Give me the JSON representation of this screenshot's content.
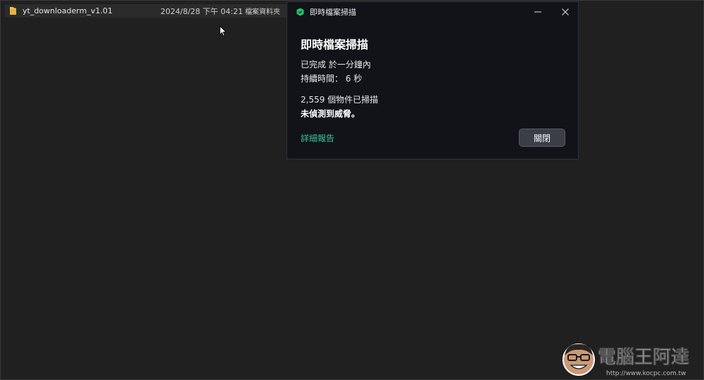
{
  "explorer": {
    "file": {
      "name": "yt_downloaderm_v1.01",
      "modified": "2024/8/28 下午 04:21",
      "type": "檔案資料夾",
      "icon": "folder-icon"
    }
  },
  "dialog": {
    "window_title": "即時檔案掃描",
    "app_icon": "shield-icon",
    "heading": "即時檔案掃描",
    "completed": "已完成 於一分鐘內",
    "duration": "持續時間： 6 秒",
    "scanned": "2,559 個物件已掃描",
    "result": "未偵測到威脅。",
    "report_link": "詳細報告",
    "close_button": "關閉",
    "accent_color": "#3fc0a0",
    "icon_color": "#24c26b"
  },
  "watermark": {
    "text": "電腦王阿達",
    "url": "http://www.kocpc.com.tw"
  }
}
